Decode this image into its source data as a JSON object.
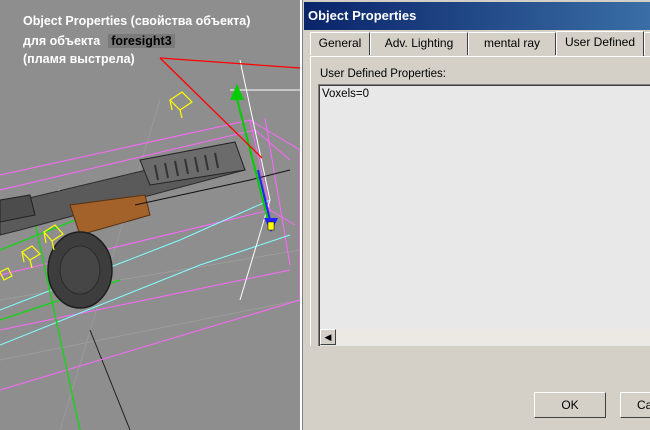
{
  "annotation": {
    "line1": "Object Properties (свойства объекта)",
    "line2": "для объекта",
    "object_name": "foresight3",
    "line3": "(пламя выстрела)"
  },
  "dialog": {
    "title": "Object Properties",
    "tabs": [
      {
        "label": "General",
        "active": false
      },
      {
        "label": "Adv. Lighting",
        "active": false
      },
      {
        "label": "mental ray",
        "active": false
      },
      {
        "label": "User Defined",
        "active": true
      }
    ],
    "user_defined": {
      "label": "User Defined Properties:",
      "value": "Voxels=0"
    },
    "ok_label": "OK",
    "cancel_label": "Ca"
  },
  "colors": {
    "title_start": "#0a246a",
    "title_end": "#3a6ea5",
    "dialog_bg": "#d4d0c8",
    "selection_box": "#ff66ff",
    "callout_line": "#ff0000",
    "helper": "#ffff00"
  }
}
